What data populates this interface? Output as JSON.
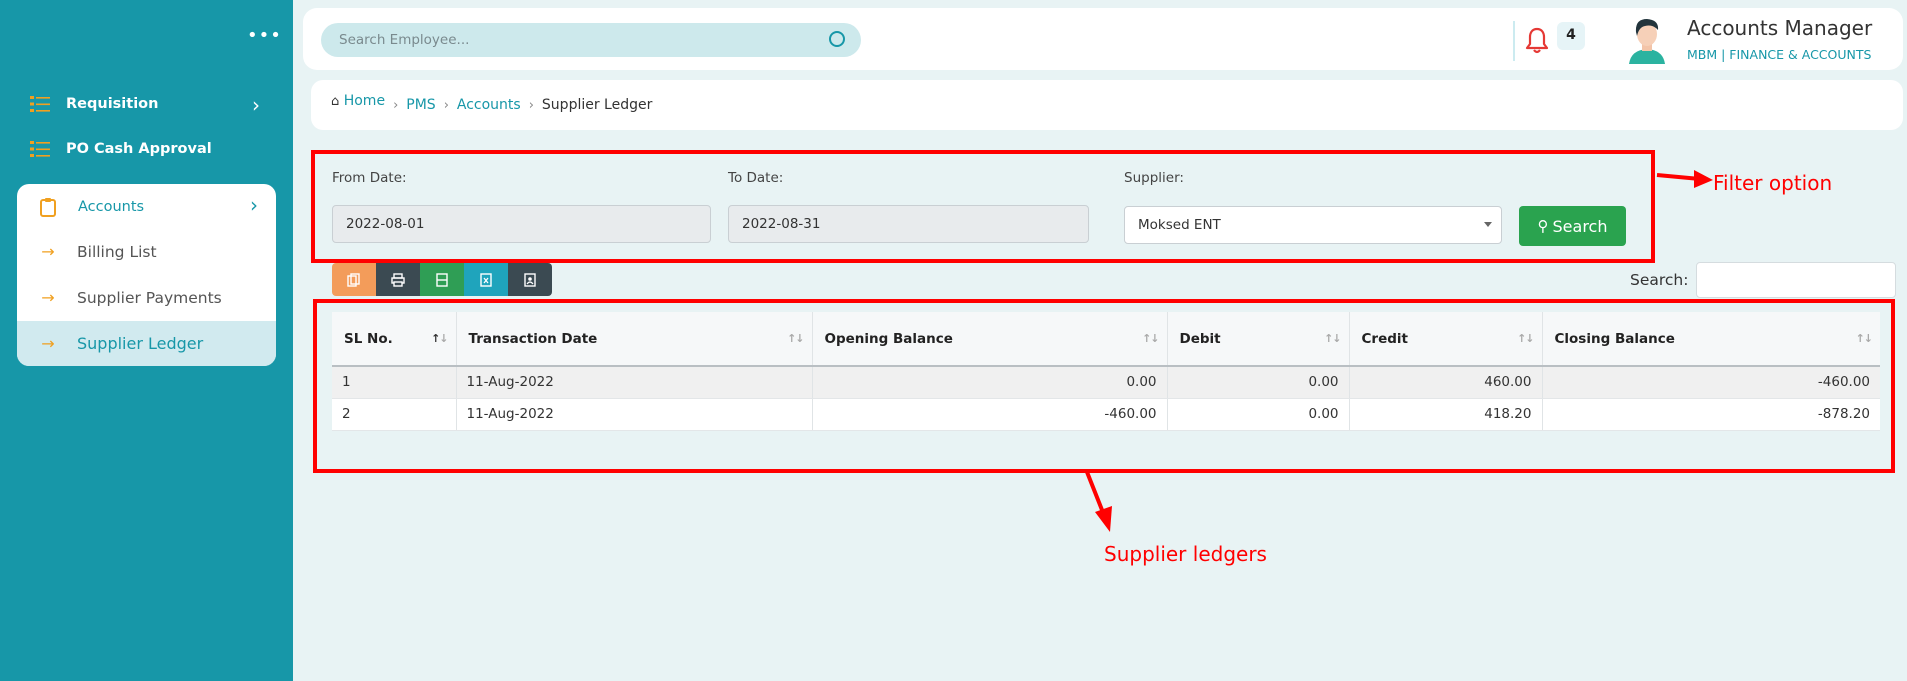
{
  "sidebar": {
    "items": [
      {
        "label": "Requisition",
        "icon": "list-icon"
      },
      {
        "label": "PO Cash Approval",
        "icon": "list-icon"
      }
    ],
    "accounts": {
      "label": "Accounts",
      "children": [
        "Billing List",
        "Supplier Payments",
        "Supplier Ledger"
      ],
      "active": "Supplier Ledger"
    }
  },
  "header": {
    "search_placeholder": "Search Employee...",
    "notification_count": "4",
    "user_name": "Accounts Manager",
    "user_role": "MBM  | FINANCE & ACCOUNTS"
  },
  "breadcrumb": [
    "Home",
    "PMS",
    "Accounts",
    "Supplier Ledger"
  ],
  "filters": {
    "from_label": "From Date:",
    "from_value": "2022-08-01",
    "to_label": "To Date:",
    "to_value": "2022-08-31",
    "supplier_label": "Supplier:",
    "supplier_value": "Moksed ENT",
    "search_button": "Search"
  },
  "table": {
    "search_label": "Search:",
    "columns": [
      "SL No.",
      "Transaction Date",
      "Opening Balance",
      "Debit",
      "Credit",
      "Closing Balance"
    ],
    "rows": [
      [
        "1",
        "11-Aug-2022",
        "0.00",
        "0.00",
        "460.00",
        "-460.00"
      ],
      [
        "2",
        "11-Aug-2022",
        "-460.00",
        "0.00",
        "418.20",
        "-878.20"
      ]
    ]
  },
  "annotations": {
    "filter": "Filter option",
    "ledger": "Supplier ledgers"
  },
  "colors": {
    "sidebar": "#1797a8",
    "accent": "#1797a8",
    "search_button": "#2aa34f",
    "annotation": "#ff0000"
  }
}
